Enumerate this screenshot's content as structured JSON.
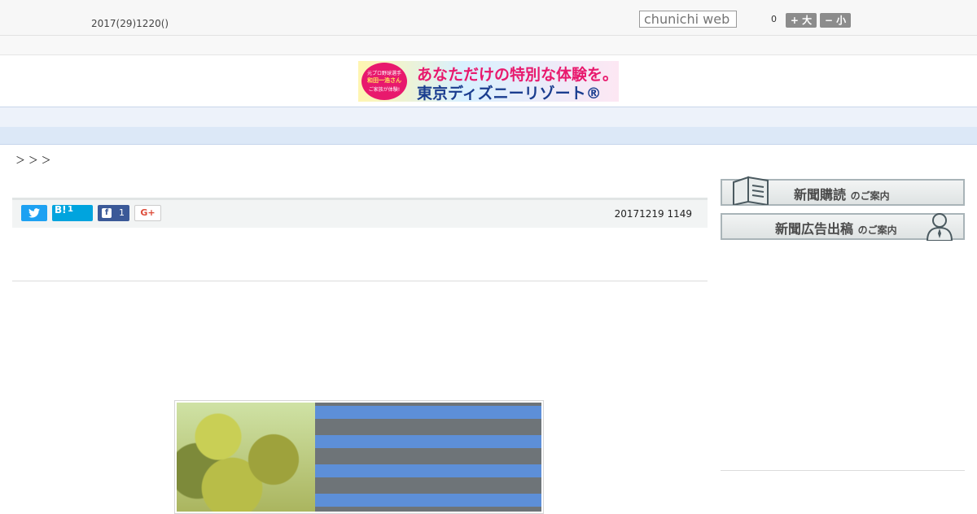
{
  "header": {
    "date_text": "2017(29)1220()",
    "search_placeholder": "chunichi web",
    "font_size_value": "0",
    "font_larger_label": "+ 大",
    "font_smaller_label": "− 小"
  },
  "banner": {
    "badge_line1": "元プロ野球選手",
    "badge_line2": "和田一浩さん",
    "badge_line3": "ご家族が体験!",
    "line1": "あなただけの特別な体験を。",
    "line2": "東京ディズニーリゾート®"
  },
  "nav": {
    "items": [
      "　　",
      "　　",
      "　　",
      "　　",
      "　　",
      "　　",
      "　　",
      "　　",
      "　　"
    ]
  },
  "breadcrumb": "＞ ＞ ＞",
  "share": {
    "twitter_icon": "twitter-bird-icon",
    "hatena_label": "B!",
    "hatena_count": "1",
    "facebook_count": "1",
    "gplus_label": "G+"
  },
  "article": {
    "published": "20171219 1149"
  },
  "sidebar": {
    "subscribe_main": "新聞購読",
    "subscribe_suffix": "のご案内",
    "advertise_main": "新聞広告出稿",
    "advertise_suffix": "のご案内"
  },
  "colors": {
    "nav_bg": "#edf2fa",
    "twitter": "#1da1f2",
    "hatena": "#00a4de",
    "facebook": "#3b5998",
    "gplus": "#dd4b39"
  }
}
